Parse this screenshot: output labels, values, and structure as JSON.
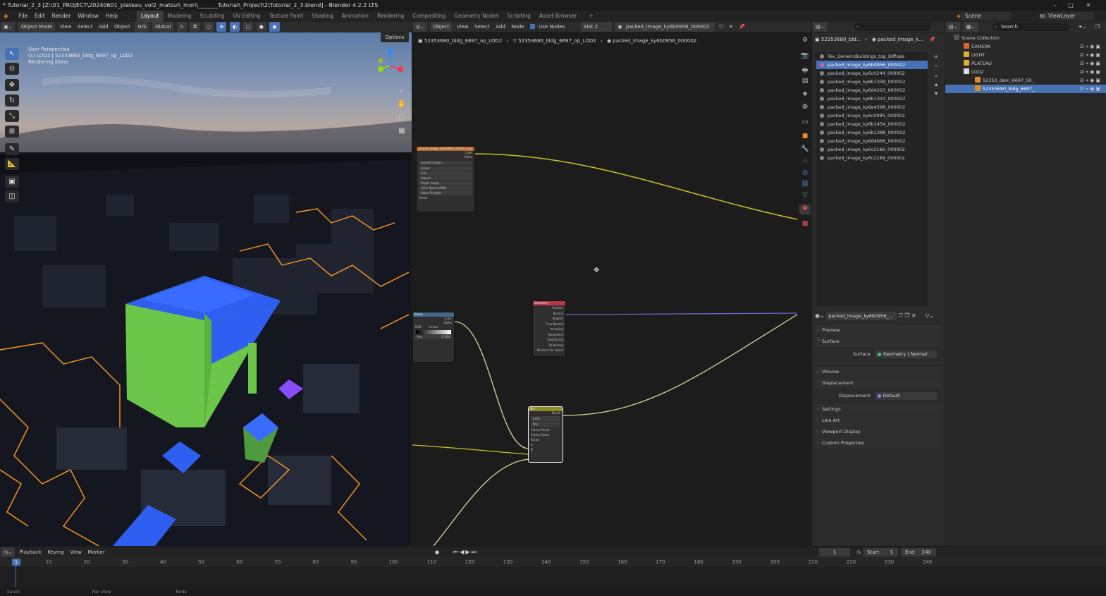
{
  "window": {
    "title": "* Tutorial_2_3 [Z:\\01_PROJECT\\20240601_plateau_vol2_matsui\\_mori\\_______Tutorial\\_Project\\2\\Tutorial_2_3.blend] - Blender 4.2.2 LTS"
  },
  "menu": [
    "File",
    "Edit",
    "Render",
    "Window",
    "Help"
  ],
  "workspaces": [
    "Layout",
    "Modeling",
    "Sculpting",
    "UV Editing",
    "Texture Paint",
    "Shading",
    "Animation",
    "Rendering",
    "Compositing",
    "Geometry Nodes",
    "Scripting",
    "Asset Browser"
  ],
  "active_workspace": "Layout",
  "topright": {
    "scene": "Scene",
    "viewlayer": "ViewLayer"
  },
  "viewport": {
    "mode": "Object Mode",
    "menus": [
      "View",
      "Select",
      "Add",
      "Object"
    ],
    "gis": "GIS",
    "transform": "Global",
    "options": "Options",
    "overlay_lines": [
      "User Perspective",
      "(1) LOD2 | 52353680_bldg_6697_op_LOD2",
      "Rendering Done"
    ]
  },
  "node_editor": {
    "object_label": "Object",
    "menus": [
      "View",
      "Select",
      "Add",
      "Node"
    ],
    "use_nodes": "Use Nodes",
    "slot": "Slot 2",
    "material": "packed_image_ky6b0956_000002",
    "breadcrumbs": [
      "52353680_bldg_6697_op_LOD2",
      "52353680_bldg_6697_op_LOD2",
      "packed_image_ky6b0956_000002"
    ]
  },
  "nodes": {
    "image": {
      "title": "packed_image_ky6b0956_000002.png",
      "out1": "Color",
      "out2": "Alpha",
      "img": "packed_image...",
      "rows": [
        "Linear",
        "Flat",
        "Repeat",
        "Single Image",
        "Color Space   sRGB",
        "Alpha     Straight",
        "Vector"
      ]
    },
    "ramp": {
      "title": "Ramp",
      "out1": "Color",
      "out2": "Alpha",
      "rgb": "RGB",
      "interp": "Linear",
      "pos": "Pos",
      "posval": "0.164"
    },
    "geometry": {
      "title": "Geometry",
      "outs": [
        "Position",
        "Normal",
        "Tangent",
        "True Normal",
        "Incoming",
        "Parametric",
        "Backfacing",
        "Pointiness",
        "Random Per Island"
      ]
    },
    "mix": {
      "title": "Mix",
      "out": "Result",
      "rows": [
        "Color",
        "Mix",
        "Clamp Result",
        "Clamp Factor",
        "Factor",
        "A",
        "B"
      ]
    }
  },
  "properties": {
    "object": "52353680_bld...",
    "material": "packed_image_k...",
    "slots": [
      "Tex_GenericBuildings_top_Diffuse",
      "packed_image_ky6b0956_000002",
      "packed_image_ky6c0244_000002",
      "packed_image_ky6b1339_000002",
      "packed_image_ky6d4293_000002",
      "packed_image_ky6b1310_000002",
      "packed_image_ky6e4598_000002",
      "packed_image_ky6c0995_000002",
      "packed_image_ky6b1454_000002",
      "packed_image_ky6b1388_000002",
      "packed_image_ky6d4666_000002",
      "packed_image_ky6c2166_000002",
      "packed_image_ky6c2169_000002"
    ],
    "selected_slot": 1,
    "mat_field": "packed_image_ky6b0956_...",
    "panels": {
      "preview": "Preview",
      "surface": "Surface",
      "surface_label": "Surface",
      "surface_value": "Geometry | Normal",
      "volume": "Volume",
      "displacement": "Displacement",
      "disp_label": "Displacement",
      "disp_value": "Default",
      "settings": "Settings",
      "lineart": "Line Art",
      "viewport_display": "Viewport Display",
      "custom": "Custom Properties"
    }
  },
  "outliner": {
    "search": "Search",
    "root": "Scene Collection",
    "rows": [
      {
        "label": "CAMERA",
        "color": "#e0612c",
        "indent": 14
      },
      {
        "label": "LIGHT",
        "color": "#e0b02c",
        "indent": 14
      },
      {
        "label": "PLATEAU",
        "color": "#e0b02c",
        "indent": 14
      },
      {
        "label": "LOD2",
        "color": "#dddddd",
        "indent": 14
      },
      {
        "label": "52353_dem_6697_50_",
        "color": "#e08a2c",
        "indent": 30
      },
      {
        "label": "52353680_bldg_6697_",
        "color": "#e08a2c",
        "indent": 30
      }
    ]
  },
  "timeline": {
    "menus": [
      "Playback",
      "Keying",
      "View",
      "Marker"
    ],
    "current": "1",
    "start_label": "Start",
    "start": "1",
    "end_label": "End",
    "end": "240",
    "ticks": [
      "10",
      "20",
      "30",
      "40",
      "50",
      "60",
      "70",
      "80",
      "90",
      "100",
      "110",
      "120",
      "130",
      "140",
      "150",
      "160",
      "170",
      "180",
      "190",
      "200",
      "210",
      "220",
      "230",
      "240"
    ]
  },
  "status": [
    "Select",
    "Pan View",
    "Node"
  ]
}
